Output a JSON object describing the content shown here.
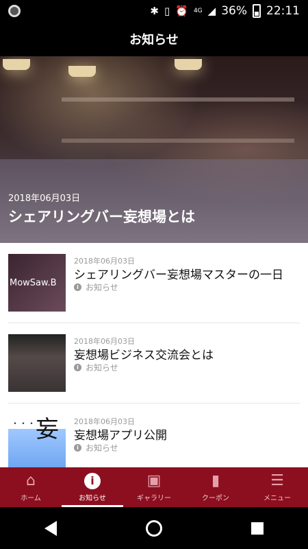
{
  "status": {
    "time": "22:11",
    "battery": "36%",
    "network": "4G"
  },
  "header": {
    "title": "お知らせ"
  },
  "hero": {
    "date": "2018年06月03日",
    "title": "シェアリングバー妄想場とは"
  },
  "items": [
    {
      "date": "2018年06月03日",
      "title": "シェアリングバー妄想場マスターの一日",
      "category": "お知らせ",
      "thumb_text": "MowSaw.B"
    },
    {
      "date": "2018年06月03日",
      "title": "妄想場ビジネス交流会とは",
      "category": "お知らせ"
    },
    {
      "date": "2018年06月03日",
      "title": "妄想場アプリ公開",
      "category": "お知らせ",
      "thumb_text": "妄"
    }
  ],
  "tabs": [
    {
      "label": "ホーム",
      "icon": "home-icon"
    },
    {
      "label": "お知らせ",
      "icon": "info-icon"
    },
    {
      "label": "ギャラリー",
      "icon": "image-icon"
    },
    {
      "label": "クーポン",
      "icon": "bookmark-icon"
    },
    {
      "label": "メニュー",
      "icon": "list-icon"
    }
  ],
  "colors": {
    "accent": "#8c0f1f",
    "header_bg": "#000000"
  }
}
